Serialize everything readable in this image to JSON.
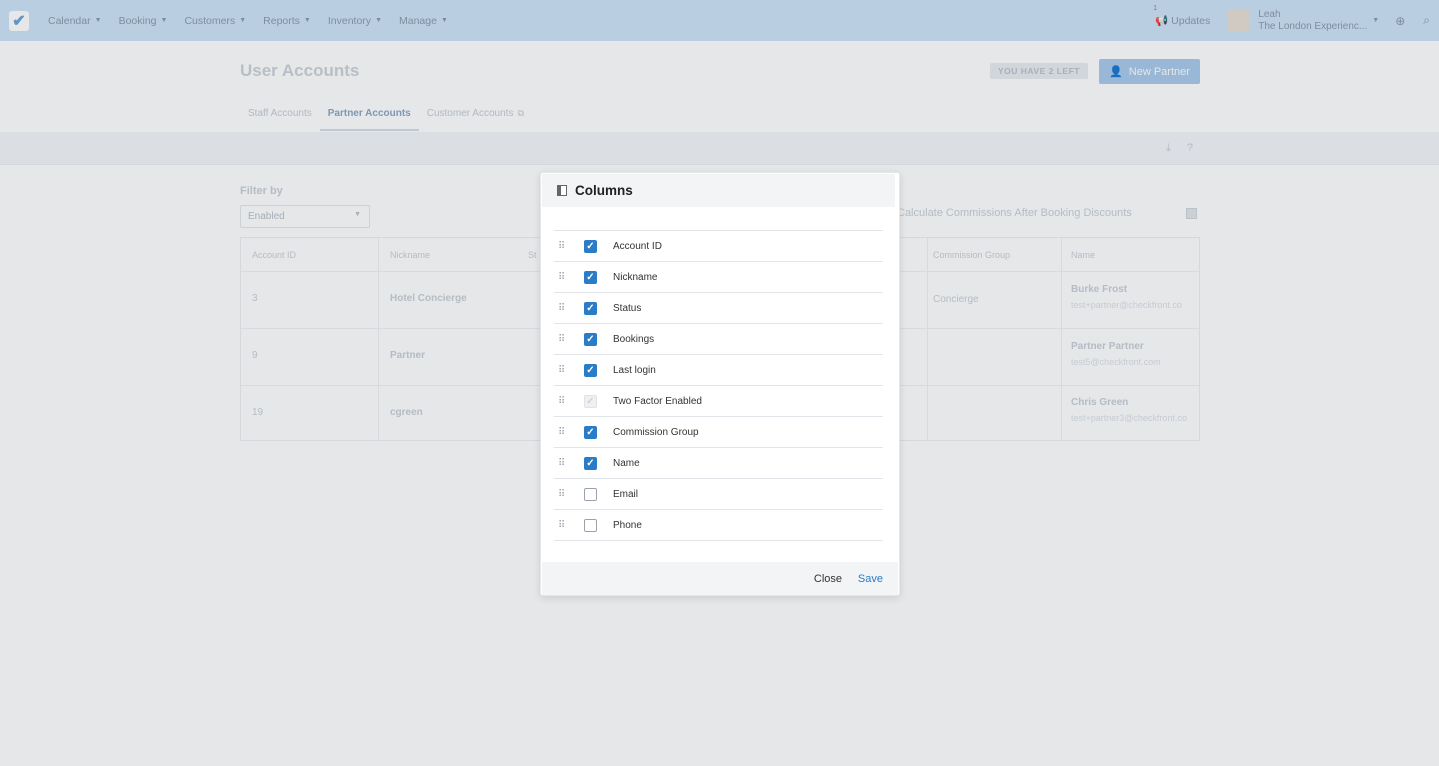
{
  "nav": {
    "menu": [
      {
        "label": "Calendar"
      },
      {
        "label": "Booking"
      },
      {
        "label": "Customers"
      },
      {
        "label": "Reports"
      },
      {
        "label": "Inventory"
      },
      {
        "label": "Manage"
      }
    ],
    "updates_label": "Updates",
    "updates_count": "1",
    "user_name": "Leah",
    "user_company": "The London Experienc..."
  },
  "page": {
    "title": "User Accounts",
    "left_badge": "YOU HAVE 2 LEFT",
    "new_partner_label": "New Partner",
    "tabs": [
      {
        "label": "Staff Accounts"
      },
      {
        "label": "Partner Accounts"
      },
      {
        "label": "Customer Accounts"
      }
    ],
    "filter_label": "Filter by",
    "filter_value": "Enabled",
    "calc_label": "Calculate Commissions After Booking Discounts"
  },
  "table": {
    "headers": [
      "Account ID",
      "Nickname",
      "St",
      "Commission Group",
      "Name"
    ],
    "rows": [
      {
        "id": "3",
        "nickname": "Hotel Concierge",
        "commission_group": "Concierge",
        "name": "Burke Frost",
        "email": "test+partner@checkfront.co"
      },
      {
        "id": "9",
        "nickname": "Partner",
        "commission_group": "",
        "name": "Partner Partner",
        "email": "test5@checkfront.com"
      },
      {
        "id": "19",
        "nickname": "cgreen",
        "commission_group": "",
        "name": "Chris Green",
        "email": "test+partner3@checkfront.co"
      }
    ]
  },
  "modal": {
    "title": "Columns",
    "columns": [
      {
        "label": "Account ID",
        "checked": true,
        "disabled": false
      },
      {
        "label": "Nickname",
        "checked": true,
        "disabled": false
      },
      {
        "label": "Status",
        "checked": true,
        "disabled": false
      },
      {
        "label": "Bookings",
        "checked": true,
        "disabled": false
      },
      {
        "label": "Last login",
        "checked": true,
        "disabled": false
      },
      {
        "label": "Two Factor Enabled",
        "checked": true,
        "disabled": true
      },
      {
        "label": "Commission Group",
        "checked": true,
        "disabled": false
      },
      {
        "label": "Name",
        "checked": true,
        "disabled": false
      },
      {
        "label": "Email",
        "checked": false,
        "disabled": false
      },
      {
        "label": "Phone",
        "checked": false,
        "disabled": false
      }
    ],
    "close_label": "Close",
    "save_label": "Save"
  },
  "colors": {
    "accent": "#2a7cc7",
    "nav_bg": "#cfe3f6"
  }
}
